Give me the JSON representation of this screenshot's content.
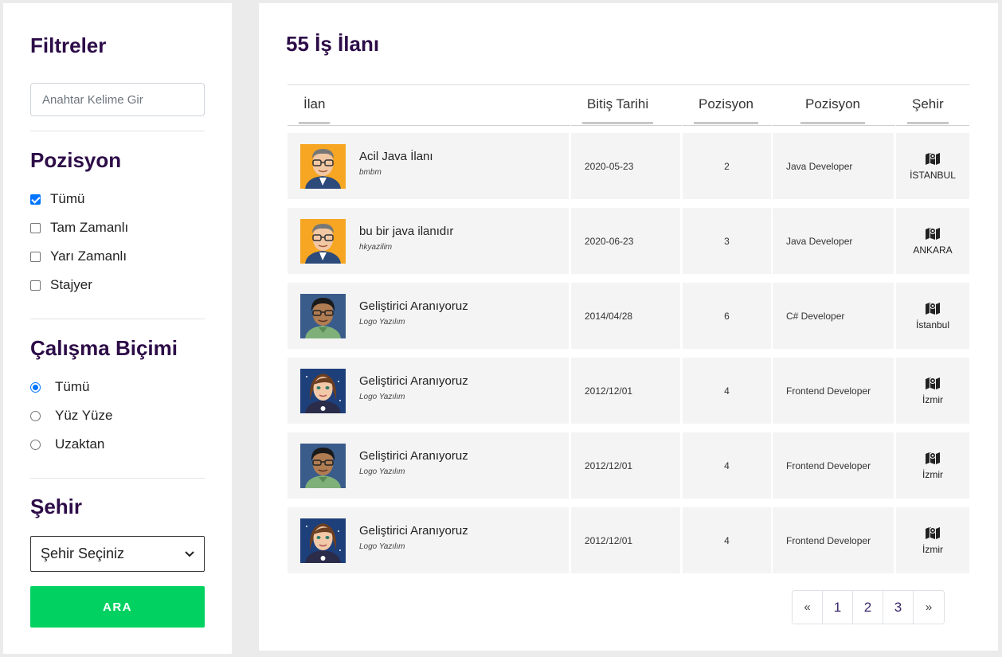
{
  "sidebar": {
    "filters_title": "Filtreler",
    "keyword_placeholder": "Anahtar Kelime Gir",
    "position_title": "Pozisyon",
    "position_options": [
      {
        "label": "Tümü",
        "checked": true
      },
      {
        "label": "Tam Zamanlı",
        "checked": false
      },
      {
        "label": "Yarı Zamanlı",
        "checked": false
      },
      {
        "label": "Stajyer",
        "checked": false
      }
    ],
    "work_type_title": "Çalışma Biçimi",
    "work_type_options": [
      {
        "label": "Tümü",
        "selected": true
      },
      {
        "label": "Yüz Yüze",
        "selected": false
      },
      {
        "label": "Uzaktan",
        "selected": false
      }
    ],
    "city_title": "Şehir",
    "city_select_value": "Şehir Seçiniz",
    "search_button": "ARA"
  },
  "main": {
    "title": "55 İş İlanı",
    "columns": [
      "İlan",
      "Bitiş Tarihi",
      "Pozisyon",
      "Pozisyon",
      "Şehir"
    ],
    "jobs": [
      {
        "title": "Acil Java İlanı",
        "company": "bmbm",
        "deadline": "2020-05-23",
        "count": "2",
        "position": "Java Developer",
        "city": "İSTANBUL",
        "avatar": "avatar-glasses"
      },
      {
        "title": "bu bir java ilanıdır",
        "company": "hkyazilim",
        "deadline": "2020-06-23",
        "count": "3",
        "position": "Java Developer",
        "city": "ANKARA",
        "avatar": "avatar-glasses"
      },
      {
        "title": "Geliştirici Aranıyoruz",
        "company": "Logo Yazılım",
        "deadline": "2014/04/28",
        "count": "6",
        "position": "C# Developer",
        "city": "İstanbul",
        "avatar": "avatar-dark-hair"
      },
      {
        "title": "Geliştirici Aranıyoruz",
        "company": "Logo Yazılım",
        "deadline": "2012/12/01",
        "count": "4",
        "position": "Frontend Developer",
        "city": "İzmir",
        "avatar": "avatar-woman"
      },
      {
        "title": "Geliştirici Aranıyoruz",
        "company": "Logo Yazılım",
        "deadline": "2012/12/01",
        "count": "4",
        "position": "Frontend Developer",
        "city": "İzmir",
        "avatar": "avatar-dark-hair"
      },
      {
        "title": "Geliştirici Aranıyoruz",
        "company": "Logo Yazılım",
        "deadline": "2012/12/01",
        "count": "4",
        "position": "Frontend Developer",
        "city": "İzmir",
        "avatar": "avatar-woman"
      }
    ],
    "pagination": {
      "prev": "«",
      "pages": [
        "1",
        "2",
        "3"
      ],
      "next": "»"
    }
  },
  "colors": {
    "heading": "#2d0c48",
    "accent_green": "#00d161",
    "checkbox_blue": "#0075ff",
    "row_bg": "#f4f4f4"
  }
}
